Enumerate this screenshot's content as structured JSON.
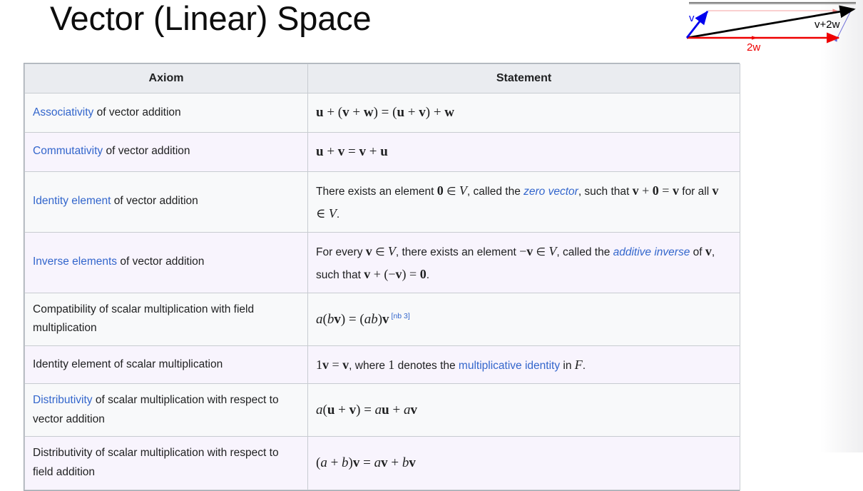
{
  "slide": {
    "title": "Vector (Linear) Space",
    "background_color": "#ffffff"
  },
  "figure": {
    "name": "vector-addition-diagram",
    "labels": {
      "v": "v",
      "two_w": "2w",
      "sum": "v+2w"
    },
    "colors": {
      "v_vector": "#0000ee",
      "w_vector": "#ee0000",
      "sum_vector": "#000000",
      "guide_line": "#f4a0a0",
      "top_rule": "#808080"
    }
  },
  "table": {
    "name": "vector-space-axioms",
    "columns": [
      "Axiom",
      "Statement"
    ],
    "link_color": "#3366cc",
    "header_bg": "#eaecf0",
    "row_bg_odd": "#f8f9fa",
    "row_bg_even": "#f8f4fd",
    "rows": [
      {
        "axiom_link": "Associativity",
        "axiom_rest": " of vector addition",
        "statement_plain": "u + (v + w) = (u + v) + w"
      },
      {
        "axiom_link": "Commutativity",
        "axiom_rest": " of vector addition",
        "statement_plain": "u + v = v + u"
      },
      {
        "axiom_link": "Identity element",
        "axiom_rest": " of vector addition",
        "statement_plain": "There exists an element 0 ∈ V, called the zero vector, such that v + 0 = v for all v ∈ V.",
        "statement_parts": {
          "p1": "There exists an element ",
          "p2": " ∈ ",
          "p3": ", called the ",
          "link": "zero vector",
          "p4": ", such that ",
          "p5": " for all ",
          "p6": "."
        }
      },
      {
        "axiom_link": "Inverse elements",
        "axiom_rest": " of vector addition",
        "statement_plain": "For every v ∈ V, there exists an element −v ∈ V, called the additive inverse of v, such that v + (−v) = 0.",
        "statement_parts": {
          "p1": "For every ",
          "p2": " ∈ ",
          "p3": ", there exists an element ",
          "p4": " ∈ ",
          "p5": ", called the ",
          "link": "additive inverse",
          "p6": " of ",
          "p7": ", such that ",
          "p8": "."
        }
      },
      {
        "axiom_plain": "Compatibility of scalar multiplication with field multiplication",
        "statement_plain": "a(bv) = (ab)v",
        "statement_note": "[nb 3]"
      },
      {
        "axiom_plain": "Identity element of scalar multiplication",
        "statement_plain": "1v = v, where 1 denotes the multiplicative identity in F.",
        "statement_parts": {
          "p1": ", where ",
          "p2": " denotes the ",
          "link": "multiplicative identity",
          "p3": " in ",
          "p4": "."
        }
      },
      {
        "axiom_link": "Distributivity",
        "axiom_rest": " of scalar multiplication with respect to vector addition",
        "statement_plain": "a(u + v) = au + av"
      },
      {
        "axiom_plain": "Distributivity of scalar multiplication with respect to field addition",
        "statement_plain": "(a + b)v = av + bv"
      }
    ]
  }
}
